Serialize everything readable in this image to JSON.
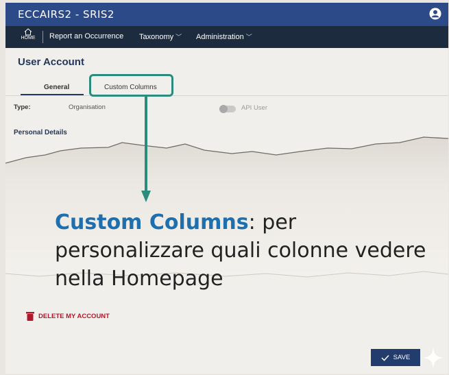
{
  "app": {
    "title": "ECCAIRS2 - SRIS2"
  },
  "nav": {
    "home_label": "HOME",
    "items": [
      "Report an Occurrence",
      "Taxonomy",
      "Administration"
    ]
  },
  "page": {
    "title": "User Account"
  },
  "tabs": [
    {
      "label": "General",
      "active": true
    },
    {
      "label": "Custom Columns",
      "active": false
    }
  ],
  "form": {
    "type_label": "Type:",
    "type_value": "Organisation",
    "api_user_label": "API User",
    "api_user_enabled": false,
    "section_title": "Personal Details"
  },
  "annotation": {
    "highlight": "Custom Columns",
    "text": ": per personalizzare quali colonne vedere nella Homepage"
  },
  "actions": {
    "delete_label": "DELETE MY ACCOUNT",
    "save_label": "SAVE"
  },
  "colors": {
    "titlebar": "#2c4a87",
    "navbar": "#1d2b3e",
    "accent_teal": "#2b8c7e",
    "caption_blue": "#1f6fae",
    "danger": "#b1182a"
  },
  "icons": [
    "user-circle-icon",
    "home-icon",
    "chevron-down-icon",
    "trash-icon",
    "check-icon",
    "sparkle-icon"
  ]
}
